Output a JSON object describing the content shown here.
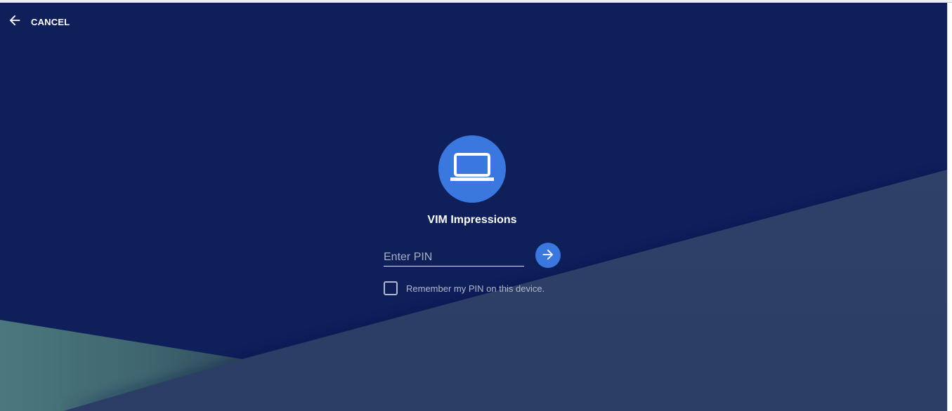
{
  "header": {
    "cancel_label": "CANCEL",
    "back_icon": "arrow-left-icon"
  },
  "device": {
    "icon": "laptop-icon",
    "name": "VIM Impressions"
  },
  "pin_form": {
    "placeholder": "Enter PIN",
    "value": "",
    "submit_icon": "arrow-right-icon",
    "remember_checked": false,
    "remember_label": "Remember my PIN on this device."
  },
  "colors": {
    "background": "#0f1f5a",
    "accent": "#3a78e0",
    "slope_panel": "#2d3f67",
    "teal_panel": "#47727a"
  }
}
